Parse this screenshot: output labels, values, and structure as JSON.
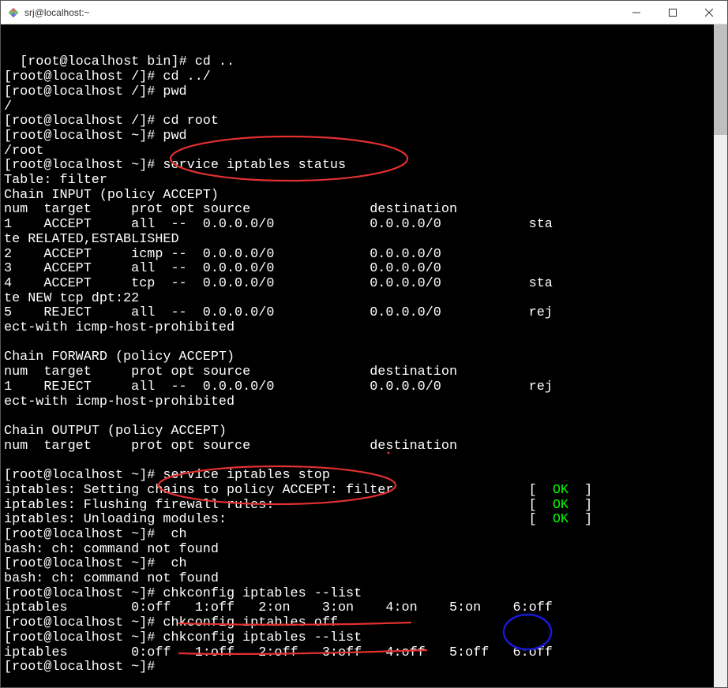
{
  "window": {
    "title": "srj@localhost:~",
    "icon": "diamond-icon"
  },
  "terminal": {
    "lines": [
      "[root@localhost bin]# cd ..",
      "[root@localhost /]# cd ../",
      "[root@localhost /]# pwd",
      "/",
      "[root@localhost /]# cd root",
      "[root@localhost ~]# pwd",
      "/root",
      "[root@localhost ~]# service iptables status",
      "Table: filter",
      "Chain INPUT (policy ACCEPT)",
      "num  target     prot opt source               destination         ",
      "1    ACCEPT     all  --  0.0.0.0/0            0.0.0.0/0           sta",
      "te RELATED,ESTABLISHED ",
      "2    ACCEPT     icmp --  0.0.0.0/0            0.0.0.0/0           ",
      "3    ACCEPT     all  --  0.0.0.0/0            0.0.0.0/0           ",
      "4    ACCEPT     tcp  --  0.0.0.0/0            0.0.0.0/0           sta",
      "te NEW tcp dpt:22 ",
      "5    REJECT     all  --  0.0.0.0/0            0.0.0.0/0           rej",
      "ect-with icmp-host-prohibited ",
      "",
      "Chain FORWARD (policy ACCEPT)",
      "num  target     prot opt source               destination         ",
      "1    REJECT     all  --  0.0.0.0/0            0.0.0.0/0           rej",
      "ect-with icmp-host-prohibited ",
      "",
      "Chain OUTPUT (policy ACCEPT)",
      "num  target     prot opt source               destination         ",
      "",
      "[root@localhost ~]# service iptables stop"
    ],
    "status_lines": [
      {
        "text": "iptables: Setting chains to policy ACCEPT: filter",
        "pad": 66,
        "status": "OK"
      },
      {
        "text": "iptables: Flushing firewall rules:",
        "pad": 66,
        "status": "OK"
      },
      {
        "text": "iptables: Unloading modules:",
        "pad": 66,
        "status": "OK"
      }
    ],
    "lines2": [
      "[root@localhost ~]#  ch",
      "bash: ch: command not found",
      "[root@localhost ~]#  ch",
      "bash: ch: command not found",
      "[root@localhost ~]# chkconfig iptables --list",
      "iptables        0:off   1:off   2:on    3:on    4:on    5:on    6:off",
      "[root@localhost ~]# chkconfig iptables off",
      "[root@localhost ~]# chkconfig iptables --list",
      "iptables        0:off   1:off   2:off   3:off   4:off   5:off   6:off",
      "[root@localhost ~]# "
    ],
    "ok_label": "OK"
  },
  "annotation_colors": {
    "red": "#e33030",
    "blue": "#1818d8"
  }
}
